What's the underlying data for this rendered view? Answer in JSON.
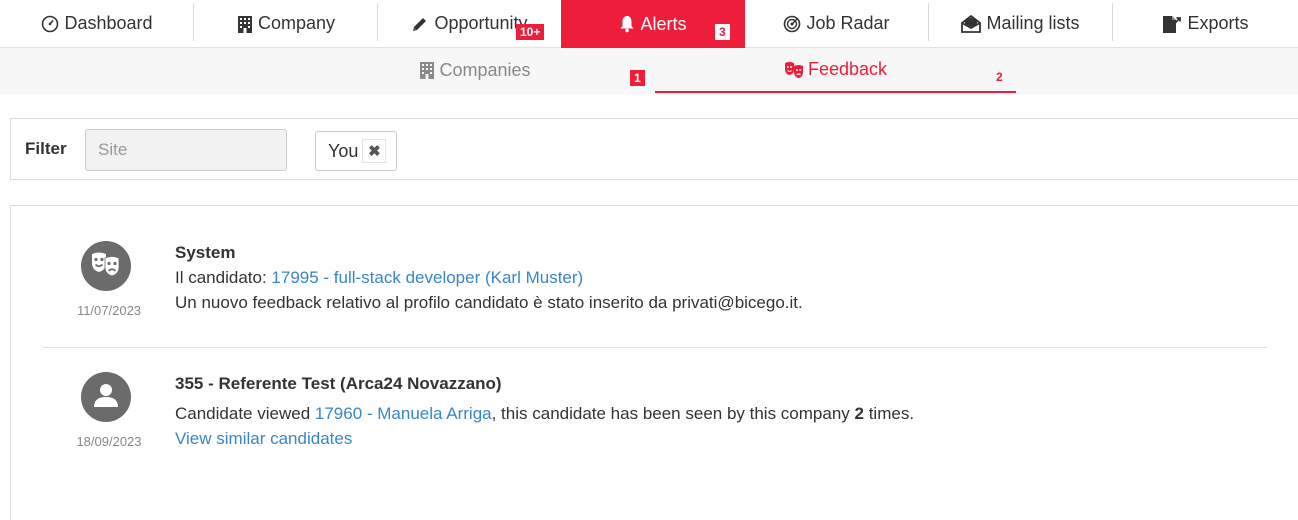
{
  "nav": {
    "tabs": [
      {
        "label": "Dashboard",
        "icon": "dashboard-icon"
      },
      {
        "label": "Company",
        "icon": "building-icon"
      },
      {
        "label": "Opportunity",
        "icon": "pencil-icon",
        "badge": "10+"
      },
      {
        "label": "Alerts",
        "icon": "bell-icon",
        "badge": "3",
        "active": true
      },
      {
        "label": "Job Radar",
        "icon": "radar-icon"
      },
      {
        "label": "Mailing lists",
        "icon": "envelope-open-icon"
      },
      {
        "label": "Exports",
        "icon": "export-file-icon"
      }
    ]
  },
  "subnav": {
    "tabs": [
      {
        "label": "Companies",
        "icon": "building-icon",
        "badge": "1"
      },
      {
        "label": "Feedback",
        "icon": "masks-icon",
        "badge": "2",
        "active": true
      }
    ]
  },
  "filter": {
    "label": "Filter",
    "site_placeholder": "Site",
    "site_value": "",
    "chip_label": "You",
    "chip_remove": "✖"
  },
  "feed": {
    "items": [
      {
        "icon": "masks-icon",
        "date": "11/07/2023",
        "title": "System",
        "line1_prefix": "Il candidato: ",
        "line1_link": "17995 - full-stack developer (Karl Muster)",
        "line2": "Un nuovo feedback relativo al profilo candidato è stato inserito da privati@bicego.it."
      },
      {
        "icon": "user-icon",
        "date": "18/09/2023",
        "title": "355 - Referente Test (Arca24 Novazzano)",
        "line1_prefix": "Candidate viewed ",
        "line1_link": "17960 - Manuela Arriga",
        "line1_middle": ", this candidate has been seen by this company ",
        "line1_count": "2",
        "line1_suffix": " times.",
        "line2_link": "View similar candidates"
      }
    ]
  },
  "colors": {
    "accent": "#ee1d3c",
    "link": "#3a85c6",
    "avatar_bg": "#6b6b6b"
  }
}
